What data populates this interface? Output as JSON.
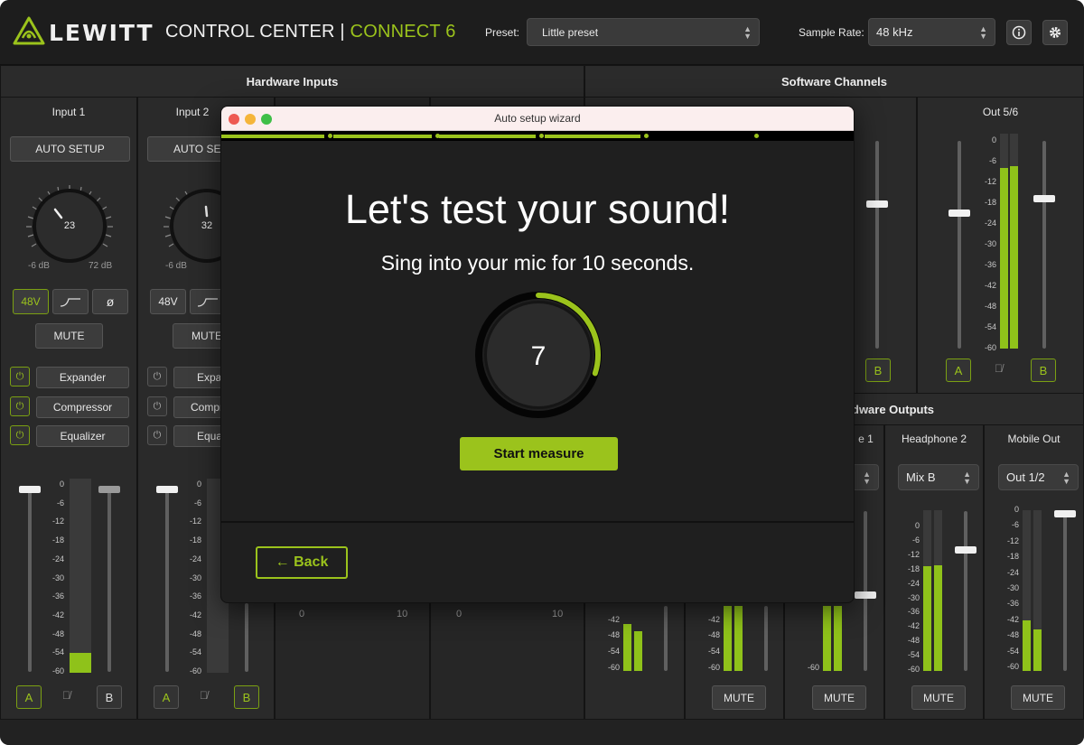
{
  "header": {
    "brand": "LEWITT",
    "product_main": "CONTROL CENTER | ",
    "product_accent": "CONNECT 6",
    "preset_label": "Preset:",
    "preset_value": "Little preset",
    "samplerate_label": "Sample Rate:",
    "samplerate_value": "48 kHz",
    "info_icon": "info-icon",
    "settings_icon": "gear-icon"
  },
  "sections": {
    "hardware_inputs": "Hardware Inputs",
    "software_channels": "Software Channels",
    "hardware_outputs_partial": "dware Outputs"
  },
  "inputs": [
    {
      "title": "Input 1",
      "auto_setup": "AUTO SETUP",
      "gain": "23",
      "gain_min": "-6 dB",
      "gain_max": "72 dB",
      "phantom": "48V",
      "phase": "ø",
      "mute": "MUTE",
      "expander": "Expander",
      "compressor": "Compressor",
      "equalizer": "Equalizer",
      "meter_level": 0.1,
      "bus_a": "A",
      "bus_b": "B"
    },
    {
      "title": "Input 2",
      "auto_setup": "AUTO SE",
      "gain": "32",
      "gain_min": "-6 dB",
      "phantom": "48V",
      "mute": "MUTE",
      "expander": "Expa",
      "compressor": "Compr",
      "equalizer": "Equa",
      "bus_a": "A",
      "bus_b": "B"
    }
  ],
  "meter_ticks": [
    "0",
    "-6",
    "-12",
    "-18",
    "-24",
    "-30",
    "-36",
    "-42",
    "-48",
    "-54",
    "-60"
  ],
  "software": {
    "out56_title": "Out 5/6",
    "bus_a": "A",
    "bus_b": "B"
  },
  "outputs": {
    "headphone1_partial": "e 1",
    "headphone2_title": "Headphone 2",
    "headphone2_source": "Mix B",
    "mobile_title": "Mobile Out",
    "mobile_source": "Out 1/2",
    "mute": "MUTE"
  },
  "hidden_knob_labels": {
    "min": "0",
    "max": "10"
  },
  "wizard": {
    "window_title": "Auto setup wizard",
    "steps_total": 5,
    "steps_complete": 4,
    "headline": "Let's test your sound!",
    "instruction": "Sing into your mic for 10 seconds.",
    "countdown": "7",
    "countdown_progress": 0.3,
    "start_button": "Start measure",
    "back_button": "← Back"
  },
  "colors": {
    "accent": "#9bc31c",
    "background": "#262626",
    "panel": "#2a2a2a",
    "titlebar": "#fbeeee"
  }
}
